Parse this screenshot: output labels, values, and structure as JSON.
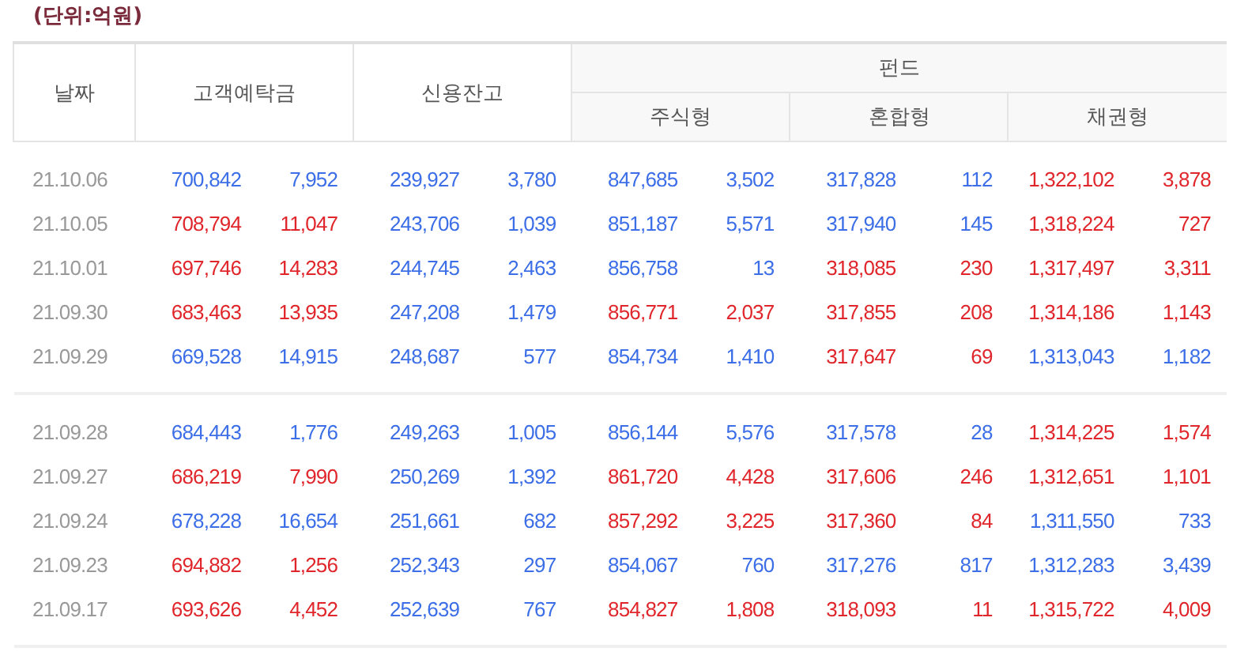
{
  "unit_label": "(단위:억원)",
  "headers": {
    "date": "날짜",
    "deposit": "고객예탁금",
    "credit": "신용잔고",
    "fund": "펀드",
    "fund_types": [
      "주식형",
      "혼합형",
      "채권형"
    ]
  },
  "groups": [
    {
      "rows": [
        {
          "date": "21.10.06",
          "cells": [
            {
              "value": "700,842",
              "change": "7,952",
              "rise": false
            },
            {
              "value": "239,927",
              "change": "3,780",
              "rise": false
            },
            {
              "value": "847,685",
              "change": "3,502",
              "rise": false
            },
            {
              "value": "317,828",
              "change": "112",
              "rise": false
            },
            {
              "value": "1,322,102",
              "change": "3,878",
              "rise": true
            }
          ]
        },
        {
          "date": "21.10.05",
          "cells": [
            {
              "value": "708,794",
              "change": "11,047",
              "rise": true
            },
            {
              "value": "243,706",
              "change": "1,039",
              "rise": false
            },
            {
              "value": "851,187",
              "change": "5,571",
              "rise": false
            },
            {
              "value": "317,940",
              "change": "145",
              "rise": false
            },
            {
              "value": "1,318,224",
              "change": "727",
              "rise": true
            }
          ]
        },
        {
          "date": "21.10.01",
          "cells": [
            {
              "value": "697,746",
              "change": "14,283",
              "rise": true
            },
            {
              "value": "244,745",
              "change": "2,463",
              "rise": false
            },
            {
              "value": "856,758",
              "change": "13",
              "rise": false
            },
            {
              "value": "318,085",
              "change": "230",
              "rise": true
            },
            {
              "value": "1,317,497",
              "change": "3,311",
              "rise": true
            }
          ]
        },
        {
          "date": "21.09.30",
          "cells": [
            {
              "value": "683,463",
              "change": "13,935",
              "rise": true
            },
            {
              "value": "247,208",
              "change": "1,479",
              "rise": false
            },
            {
              "value": "856,771",
              "change": "2,037",
              "rise": true
            },
            {
              "value": "317,855",
              "change": "208",
              "rise": true
            },
            {
              "value": "1,314,186",
              "change": "1,143",
              "rise": true
            }
          ]
        },
        {
          "date": "21.09.29",
          "cells": [
            {
              "value": "669,528",
              "change": "14,915",
              "rise": false
            },
            {
              "value": "248,687",
              "change": "577",
              "rise": false
            },
            {
              "value": "854,734",
              "change": "1,410",
              "rise": false
            },
            {
              "value": "317,647",
              "change": "69",
              "rise": true
            },
            {
              "value": "1,313,043",
              "change": "1,182",
              "rise": false
            }
          ]
        }
      ]
    },
    {
      "rows": [
        {
          "date": "21.09.28",
          "cells": [
            {
              "value": "684,443",
              "change": "1,776",
              "rise": false
            },
            {
              "value": "249,263",
              "change": "1,005",
              "rise": false
            },
            {
              "value": "856,144",
              "change": "5,576",
              "rise": false
            },
            {
              "value": "317,578",
              "change": "28",
              "rise": false
            },
            {
              "value": "1,314,225",
              "change": "1,574",
              "rise": true
            }
          ]
        },
        {
          "date": "21.09.27",
          "cells": [
            {
              "value": "686,219",
              "change": "7,990",
              "rise": true
            },
            {
              "value": "250,269",
              "change": "1,392",
              "rise": false
            },
            {
              "value": "861,720",
              "change": "4,428",
              "rise": true
            },
            {
              "value": "317,606",
              "change": "246",
              "rise": true
            },
            {
              "value": "1,312,651",
              "change": "1,101",
              "rise": true
            }
          ]
        },
        {
          "date": "21.09.24",
          "cells": [
            {
              "value": "678,228",
              "change": "16,654",
              "rise": false
            },
            {
              "value": "251,661",
              "change": "682",
              "rise": false
            },
            {
              "value": "857,292",
              "change": "3,225",
              "rise": true
            },
            {
              "value": "317,360",
              "change": "84",
              "rise": true
            },
            {
              "value": "1,311,550",
              "change": "733",
              "rise": false
            }
          ]
        },
        {
          "date": "21.09.23",
          "cells": [
            {
              "value": "694,882",
              "change": "1,256",
              "rise": true
            },
            {
              "value": "252,343",
              "change": "297",
              "rise": false
            },
            {
              "value": "854,067",
              "change": "760",
              "rise": false
            },
            {
              "value": "317,276",
              "change": "817",
              "rise": false
            },
            {
              "value": "1,312,283",
              "change": "3,439",
              "rise": false
            }
          ]
        },
        {
          "date": "21.09.17",
          "cells": [
            {
              "value": "693,626",
              "change": "4,452",
              "rise": true
            },
            {
              "value": "252,639",
              "change": "767",
              "rise": false
            },
            {
              "value": "854,827",
              "change": "1,808",
              "rise": true
            },
            {
              "value": "318,093",
              "change": "11",
              "rise": true
            },
            {
              "value": "1,315,722",
              "change": "4,009",
              "rise": true
            }
          ]
        }
      ]
    }
  ]
}
